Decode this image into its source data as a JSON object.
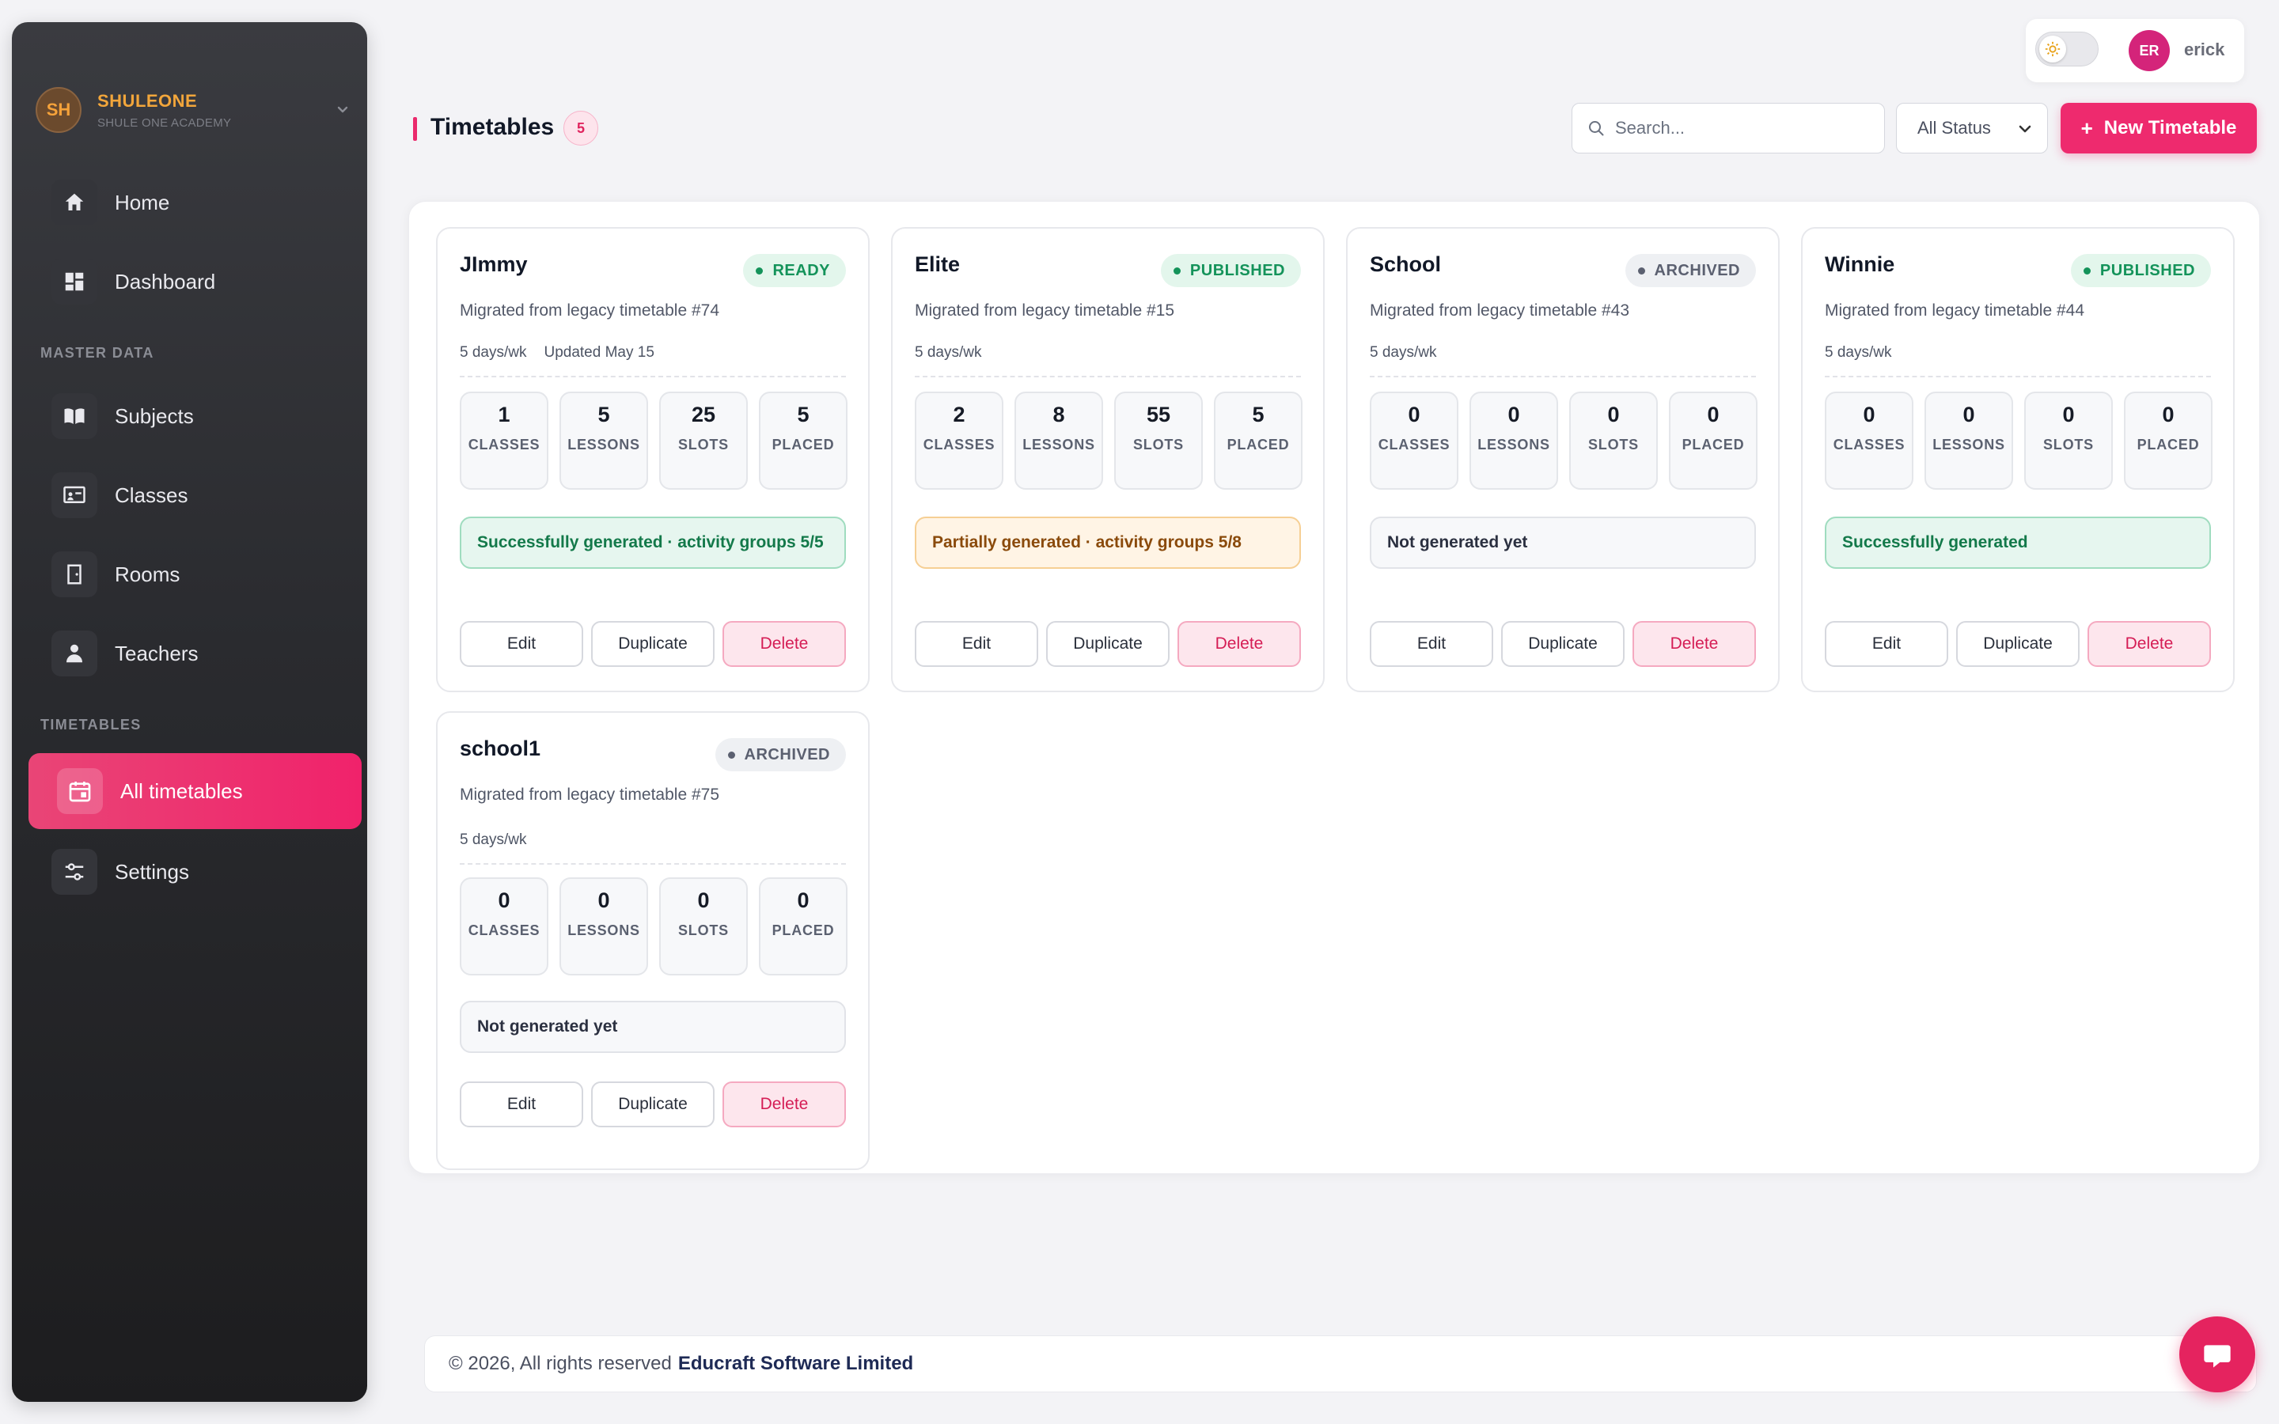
{
  "brand": {
    "initials": "SH",
    "name": "SHULEONE",
    "subtitle": "SHULE ONE ACADEMY"
  },
  "nav": {
    "home": "Home",
    "dashboard": "Dashboard",
    "section_master": "MASTER DATA",
    "subjects": "Subjects",
    "classes": "Classes",
    "rooms": "Rooms",
    "teachers": "Teachers",
    "section_timetables": "TIMETABLES",
    "all_timetables": "All timetables",
    "settings": "Settings"
  },
  "user": {
    "initials": "ER",
    "name": "erick"
  },
  "header": {
    "title": "Timetables",
    "count": "5",
    "search_placeholder": "Search...",
    "status_filter": "All Status",
    "new_button": "New Timetable"
  },
  "stat_labels": {
    "classes": "CLASSES",
    "lessons": "LESSONS",
    "slots": "SLOTS",
    "placed": "PLACED"
  },
  "actions": {
    "edit": "Edit",
    "duplicate": "Duplicate",
    "delete": "Delete"
  },
  "cards": [
    {
      "name": "JImmy",
      "status": "READY",
      "description": "Migrated from legacy timetable #74",
      "days": "5 days/wk",
      "updated": "Updated May 15",
      "classes": "1",
      "lessons": "5",
      "slots": "25",
      "placed": "5",
      "generation": "Successfully generated · activity groups 5/5"
    },
    {
      "name": "Elite",
      "status": "PUBLISHED",
      "description": "Migrated from legacy timetable #15",
      "days": "5 days/wk",
      "classes": "2",
      "lessons": "8",
      "slots": "55",
      "placed": "5",
      "generation": "Partially generated · activity groups 5/8"
    },
    {
      "name": "School",
      "status": "ARCHIVED",
      "description": "Migrated from legacy timetable #43",
      "days": "5 days/wk",
      "classes": "0",
      "lessons": "0",
      "slots": "0",
      "placed": "0",
      "generation": "Not generated yet"
    },
    {
      "name": "Winnie",
      "status": "PUBLISHED",
      "description": "Migrated from legacy timetable #44",
      "days": "5 days/wk",
      "classes": "0",
      "lessons": "0",
      "slots": "0",
      "placed": "0",
      "generation": "Successfully generated"
    },
    {
      "name": "school1",
      "status": "ARCHIVED",
      "description": "Migrated from legacy timetable #75",
      "days": "5 days/wk",
      "classes": "0",
      "lessons": "0",
      "slots": "0",
      "placed": "0",
      "generation": "Not generated yet"
    }
  ],
  "footer": {
    "copyright": "© 2026, All rights reserved",
    "company": "Educraft Software Limited"
  },
  "colors": {
    "accent": "#ee2a6e",
    "brand": "#f2a63b",
    "status_green": "#14935a",
    "status_gray": "#5b6070",
    "amber": "#8a4a0b"
  }
}
